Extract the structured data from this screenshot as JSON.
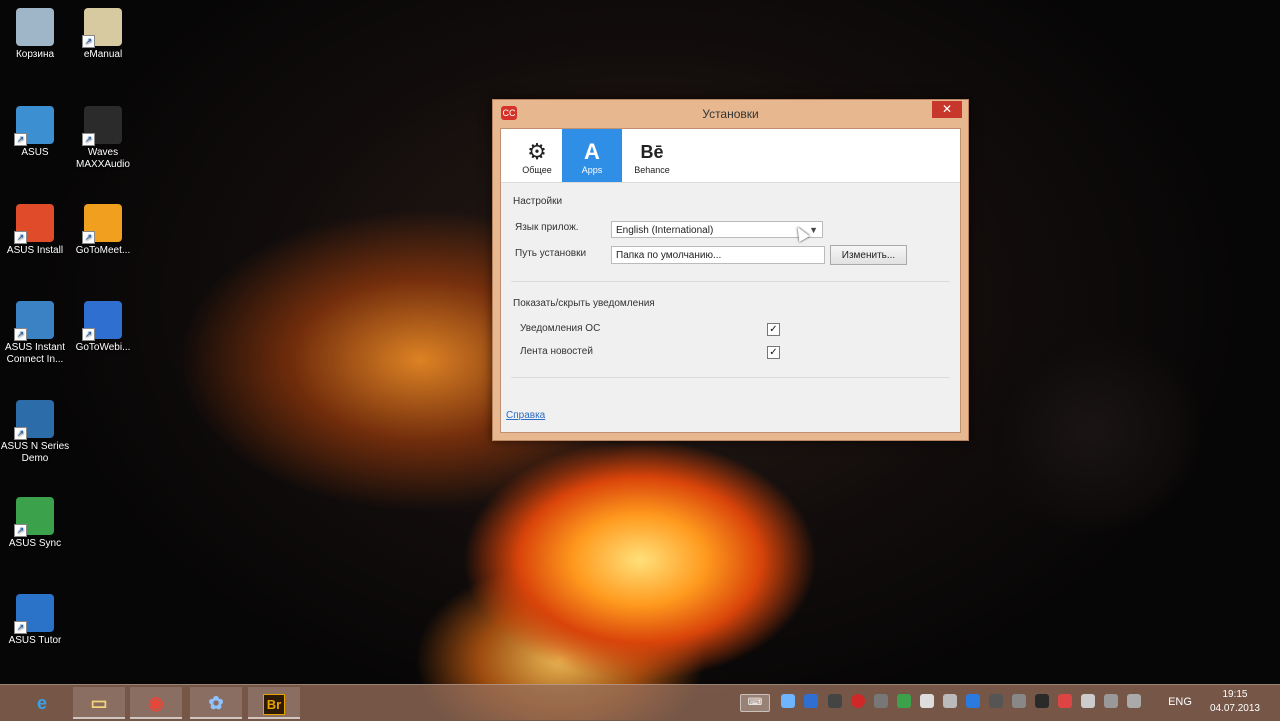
{
  "desktop": {
    "icons": [
      {
        "label": "Корзина",
        "icon": "recycle-bin-icon",
        "color": "#9fb6c8"
      },
      {
        "label": "eManual",
        "icon": "emanual-icon",
        "color": "#d8caa0"
      },
      {
        "label": "ASUS",
        "icon": "asus-folder-icon",
        "color": "#3c8fd0"
      },
      {
        "label": "Waves MAXXAudio",
        "icon": "waves-audio-icon",
        "color": "#2b2b2b"
      },
      {
        "label": "ASUS Install",
        "icon": "asus-install-icon",
        "color": "#e04b2a"
      },
      {
        "label": "GoToMeet...",
        "icon": "gotomeeting-icon",
        "color": "#f0a01e"
      },
      {
        "label": "ASUS Instant Connect In...",
        "icon": "asus-instant-connect-icon",
        "color": "#3b82c4"
      },
      {
        "label": "GoToWebi...",
        "icon": "gotowebinar-icon",
        "color": "#2f6fd0"
      },
      {
        "label": "ASUS N Series Demo",
        "icon": "asus-n-series-icon",
        "color": "#2c6ca8"
      },
      {
        "label": "ASUS Sync",
        "icon": "asus-sync-icon",
        "color": "#3ba24b"
      },
      {
        "label": "ASUS Tutor",
        "icon": "asus-tutor-icon",
        "color": "#2b73c9"
      }
    ]
  },
  "dialog": {
    "title": "Установки",
    "close_glyph": "✕",
    "tabs": [
      {
        "label": "Общее",
        "icon": "gear-icon",
        "glyph": "⚙"
      },
      {
        "label": "Apps",
        "icon": "adobe-icon",
        "glyph": "A"
      },
      {
        "label": "Behance",
        "icon": "behance-icon",
        "glyph": "Bē"
      }
    ],
    "settings_group": "Настройки",
    "language_label": "Язык прилож.",
    "language_value": "English (International)",
    "install_path_label": "Путь установки",
    "install_path_value": "Папка по умолчанию...",
    "change_button": "Изменить...",
    "notifications_group": "Показать/скрыть уведомления",
    "os_notifications_label": "Уведомления ОС",
    "os_notifications_checked": true,
    "news_feed_label": "Лента новостей",
    "news_feed_checked": true,
    "check_glyph": "✓",
    "help_link": "Справка"
  },
  "taskbar": {
    "apps": [
      {
        "name": "internet-explorer",
        "glyph": "e",
        "color": "#3aa0e8"
      },
      {
        "name": "file-explorer",
        "glyph": "▭",
        "color": "#f2d27a"
      },
      {
        "name": "chrome",
        "glyph": "◉",
        "color": "#e5483a"
      },
      {
        "name": "gotomeeting",
        "glyph": "✿",
        "color": "#8fc2ff"
      },
      {
        "name": "adobe-bridge",
        "glyph": "Br",
        "color": "#e8a200"
      }
    ],
    "language": "ENG",
    "time": "19:15",
    "date": "04.07.2013"
  },
  "colors": {
    "accent": "#2f8ee6",
    "close": "#c7372c"
  }
}
